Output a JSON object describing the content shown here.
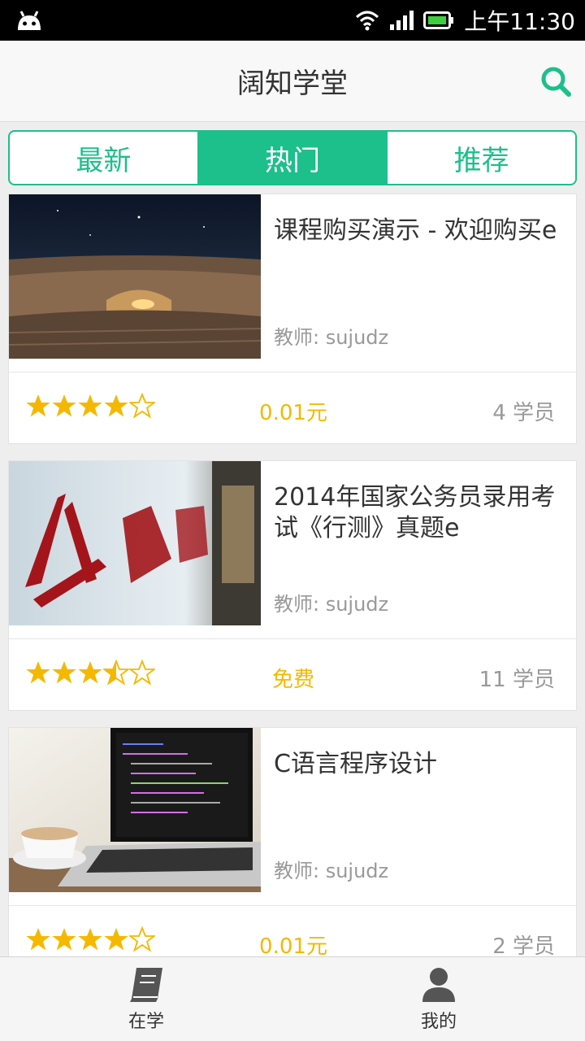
{
  "status_bar": {
    "time": "上午11:30"
  },
  "header": {
    "title": "阔知学堂",
    "search_icon": "search-icon"
  },
  "tabs": [
    {
      "label": "最新",
      "active": false
    },
    {
      "label": "热门",
      "active": true
    },
    {
      "label": "推荐",
      "active": false
    }
  ],
  "courses": [
    {
      "title": "课程购买演示 - 欢迎购买e",
      "teacher": "教师: sujudz",
      "rating": 4,
      "price": "0.01元",
      "students": "4 学员",
      "thumb": "book-night-image"
    },
    {
      "title": "2014年国家公务员录用考试《行测》真题e",
      "teacher": "教师: sujudz",
      "rating": 3.5,
      "price": "免费",
      "students": "11 学员",
      "thumb": "civil-servant-image"
    },
    {
      "title": "C语言程序设计",
      "teacher": "教师: sujudz",
      "rating": 4,
      "price": "0.01元",
      "students": "2 学员",
      "thumb": "laptop-coffee-image"
    }
  ],
  "bottom_nav": [
    {
      "label": "在学",
      "icon": "book-icon"
    },
    {
      "label": "我的",
      "icon": "user-icon"
    }
  ],
  "colors": {
    "accent": "#1dbf8b",
    "star": "#f5b800",
    "price": "#f5b800"
  }
}
